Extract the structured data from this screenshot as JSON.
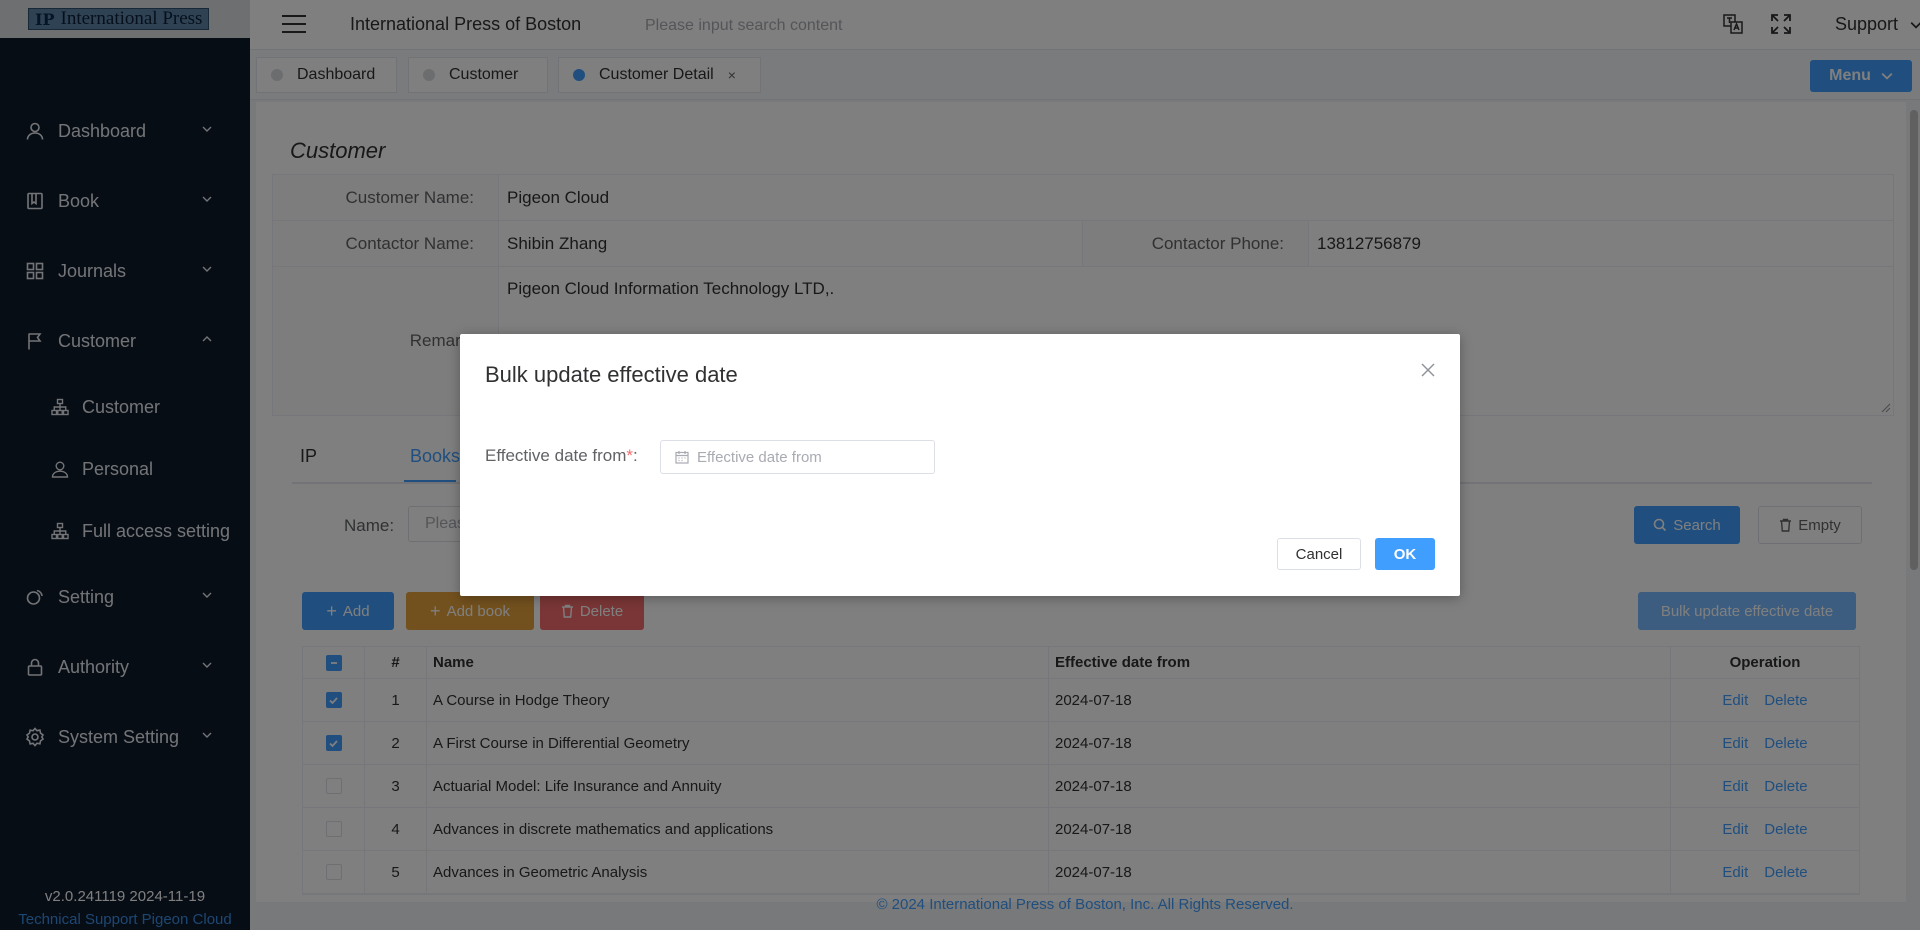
{
  "logo": {
    "mark": "IP",
    "text": "International Press"
  },
  "sidebar": {
    "items": [
      {
        "label": "Dashboard",
        "icon": "user-icon"
      },
      {
        "label": "Book",
        "icon": "book-icon"
      },
      {
        "label": "Journals",
        "icon": "grid-icon"
      },
      {
        "label": "Customer",
        "icon": "flag-icon",
        "expanded": true
      }
    ],
    "sub_items": [
      {
        "label": "Customer",
        "icon": "org-chart-icon"
      },
      {
        "label": "Personal",
        "icon": "person-icon"
      },
      {
        "label": "Full access setting",
        "icon": "org-chart-icon"
      }
    ],
    "items_after": [
      {
        "label": "Setting",
        "icon": "setting-icon"
      },
      {
        "label": "Authority",
        "icon": "lock-icon"
      },
      {
        "label": "System Setting",
        "icon": "gear-icon"
      }
    ],
    "version": "v2.0.241119 2024-11-19",
    "tech_support": "Technical Support Pigeon Cloud"
  },
  "header": {
    "title": "International Press of Boston",
    "search_placeholder": "Please input search content",
    "support_label": "Support"
  },
  "tabs": [
    {
      "label": "Dashboard",
      "active": false
    },
    {
      "label": "Customer",
      "active": false
    },
    {
      "label": "Customer Detail",
      "active": true,
      "close": "×"
    }
  ],
  "menu_button": "Menu",
  "customer": {
    "title": "Customer",
    "name_label": "Customer Name:",
    "name": "Pigeon Cloud",
    "contactor_label": "Contactor Name:",
    "contactor": "Shibin Zhang",
    "phone_label": "Contactor Phone:",
    "phone": "13812756879",
    "remark_label": "Remark:",
    "remark": "Pigeon Cloud Information Technology LTD,."
  },
  "subtabs": [
    "IP",
    "Books"
  ],
  "filter": {
    "name_label": "Name:",
    "name_placeholder": "Please input name",
    "search_button": "Search",
    "empty_button": "Empty"
  },
  "actions": {
    "add": "Add",
    "add_book": "Add book",
    "delete": "Delete",
    "bulk_update": "Bulk update effective date"
  },
  "table": {
    "headers": [
      "#",
      "Name",
      "Effective date from",
      "Operation"
    ],
    "edit_label": "Edit",
    "delete_label": "Delete",
    "rows": [
      {
        "num": "1",
        "name": "A Course in Hodge Theory",
        "date": "2024-07-18",
        "checked": true
      },
      {
        "num": "2",
        "name": "A First Course in Differential Geometry",
        "date": "2024-07-18",
        "checked": true
      },
      {
        "num": "3",
        "name": "Actuarial Model: Life Insurance and Annuity",
        "date": "2024-07-18",
        "checked": false
      },
      {
        "num": "4",
        "name": "Advances in discrete mathematics and applications",
        "date": "2024-07-18",
        "checked": false
      },
      {
        "num": "5",
        "name": "Advances in Geometric Analysis",
        "date": "2024-07-18",
        "checked": false
      }
    ]
  },
  "copyright": "© 2024 International Press of Boston, Inc. All Rights Reserved.",
  "modal": {
    "title": "Bulk update effective date",
    "field_label": "Effective date from",
    "required_mark": "*",
    "colon": ":",
    "date_placeholder": "Effective date from",
    "cancel": "Cancel",
    "ok": "OK"
  },
  "colors": {
    "primary": "#409eff",
    "warning": "#e6a23c",
    "danger": "#f56c6c",
    "sidebar_bg": "#0f1a2b"
  }
}
